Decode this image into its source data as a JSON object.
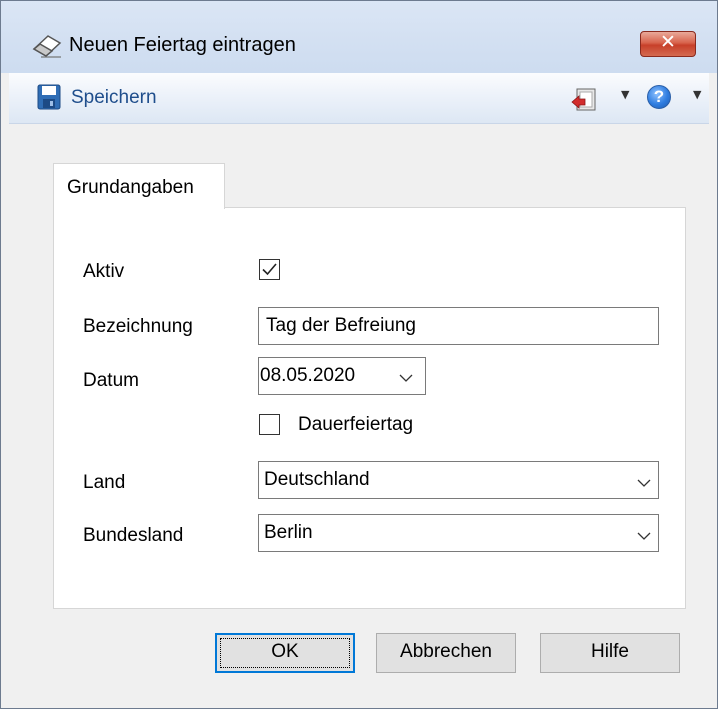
{
  "window": {
    "title": "Neuen Feiertag eintragen",
    "close_glyph": "✕"
  },
  "toolbar": {
    "save_label": "Speichern",
    "help_glyph": "?"
  },
  "tabs": [
    {
      "label": "Grundangaben",
      "active": true
    }
  ],
  "form": {
    "aktiv_label": "Aktiv",
    "aktiv_checked": true,
    "bezeichnung_label": "Bezeichnung",
    "bezeichnung_value": "Tag der Befreiung",
    "datum_label": "Datum",
    "datum_value": "08.05.2020",
    "dauerfeiertag_label": "Dauerfeiertag",
    "dauerfeiertag_checked": false,
    "land_label": "Land",
    "land_value": "Deutschland",
    "bundesland_label": "Bundesland",
    "bundesland_value": "Berlin"
  },
  "buttons": {
    "ok": "OK",
    "cancel": "Abbrechen",
    "help": "Hilfe"
  },
  "colors": {
    "accent": "#0078d7",
    "toolbar_text": "#1f4e8c",
    "close_button": "#c7402a"
  }
}
